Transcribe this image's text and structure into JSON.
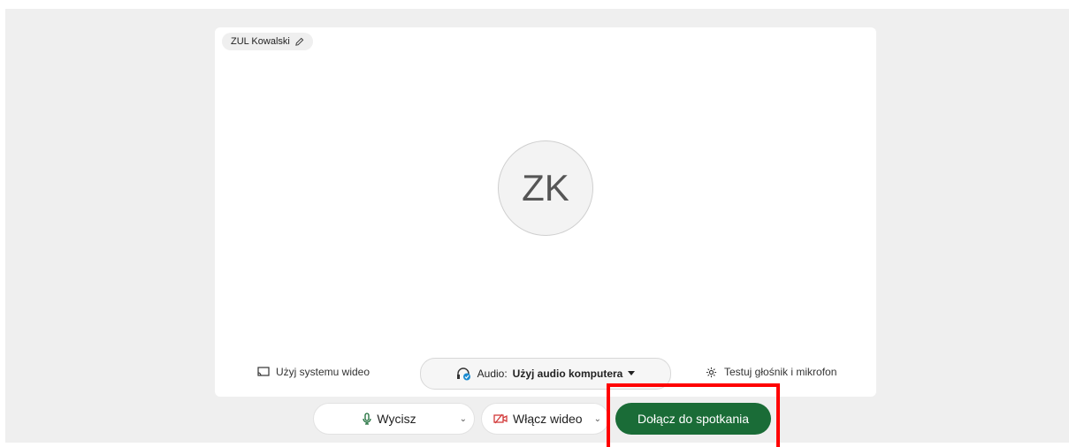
{
  "colors": {
    "stage_background": "#efefef",
    "join_button": "#1a6c37",
    "highlight": "#ff0000",
    "video_off_icon": "#d23a3a",
    "mic_icon": "#1a6c37",
    "audio_badge": "#1b8bd0"
  },
  "preview": {
    "user_name": "ZUL Kowalski",
    "avatar_initials": "ZK"
  },
  "audio_bar": {
    "video_system_label": "Użyj systemu wideo",
    "audio_prefix": "Audio:",
    "audio_value": "Użyj audio komputera",
    "test_label": "Testuj głośnik i mikrofon"
  },
  "controls": {
    "mute_label": "Wycisz",
    "video_label": "Włącz wideo",
    "join_label": "Dołącz do spotkania"
  },
  "icons": {
    "edit": "pencil-icon",
    "video_system": "screen-cast-icon",
    "audio": "headset-icon",
    "test": "gear-icon",
    "mute": "microphone-icon",
    "video": "video-off-icon",
    "caret": "chevron-down-icon"
  }
}
